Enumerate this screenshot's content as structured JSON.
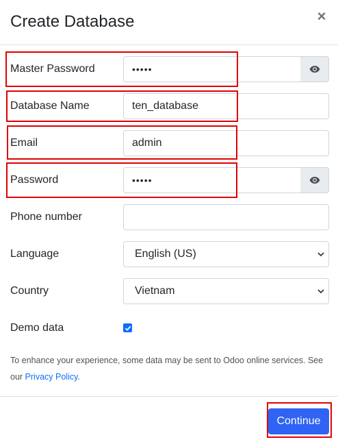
{
  "dialog": {
    "title": "Create Database",
    "close_glyph": "×",
    "close_icon": "close-icon"
  },
  "fields": {
    "master_password": {
      "label": "Master Password",
      "value": "•••••",
      "toggle_icon": "eye-icon"
    },
    "database_name": {
      "label": "Database Name",
      "value": "ten_database"
    },
    "email": {
      "label": "Email",
      "value": "admin"
    },
    "password": {
      "label": "Password",
      "value": "•••••",
      "toggle_icon": "eye-icon"
    },
    "phone_number": {
      "label": "Phone number",
      "value": ""
    },
    "language": {
      "label": "Language",
      "value": "English (US)"
    },
    "country": {
      "label": "Country",
      "value": "Vietnam"
    },
    "demo_data": {
      "label": "Demo data",
      "checked": true
    }
  },
  "notice": {
    "text": "To enhance your experience, some data may be sent to Odoo online services. See our ",
    "link": "Privacy Policy",
    "end": "."
  },
  "footer": {
    "continue_label": "Continue"
  },
  "colors": {
    "primary": "#2f63f3",
    "link": "#0d6efd",
    "highlight": "#e00000",
    "addon_bg": "#e9ecef"
  }
}
